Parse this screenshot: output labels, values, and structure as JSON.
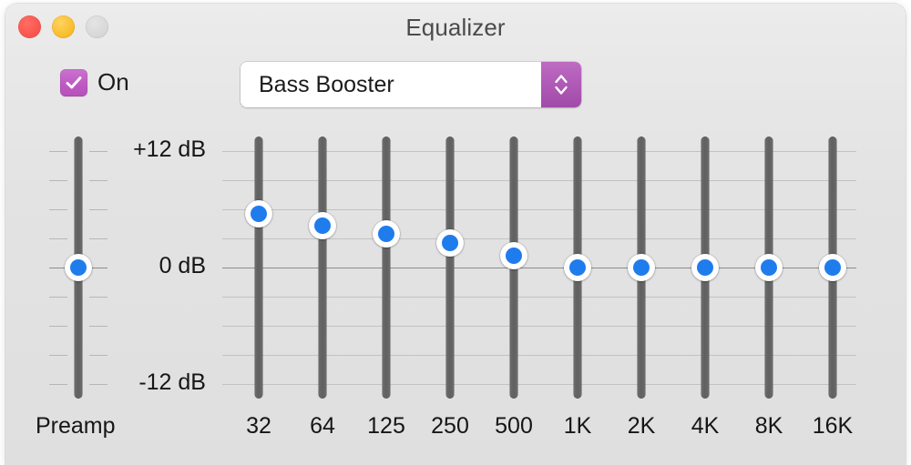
{
  "window": {
    "title": "Equalizer",
    "traffic_lights": [
      {
        "name": "close",
        "color": "#f9554e"
      },
      {
        "name": "minimize",
        "color": "#f9bd2e"
      },
      {
        "name": "zoom",
        "color": "#d8d8d8"
      }
    ]
  },
  "controls": {
    "on_checkbox": {
      "label": "On",
      "checked": true,
      "accent_color": "#bf5ac4"
    },
    "preset_popup": {
      "value": "Bass Booster",
      "stepper_color": "#b059b7"
    }
  },
  "equalizer": {
    "scale_labels": [
      {
        "text": "+12 dB",
        "db": 12
      },
      {
        "text": "0 dB",
        "db": 0
      },
      {
        "text": "-12 dB",
        "db": -12
      }
    ],
    "axis": {
      "min_db": -12,
      "max_db": 12,
      "gridline_step_db": 3
    },
    "thumb_color": "#1f7ced",
    "track_color": "#606060",
    "preamp": {
      "label": "Preamp",
      "value_db": 0
    },
    "bands": [
      {
        "label": "32",
        "value_db": 5.5
      },
      {
        "label": "64",
        "value_db": 4.3
      },
      {
        "label": "125",
        "value_db": 3.5
      },
      {
        "label": "250",
        "value_db": 2.5
      },
      {
        "label": "500",
        "value_db": 1.2
      },
      {
        "label": "1K",
        "value_db": 0
      },
      {
        "label": "2K",
        "value_db": 0
      },
      {
        "label": "4K",
        "value_db": 0
      },
      {
        "label": "8K",
        "value_db": 0
      },
      {
        "label": "16K",
        "value_db": 0
      }
    ]
  }
}
